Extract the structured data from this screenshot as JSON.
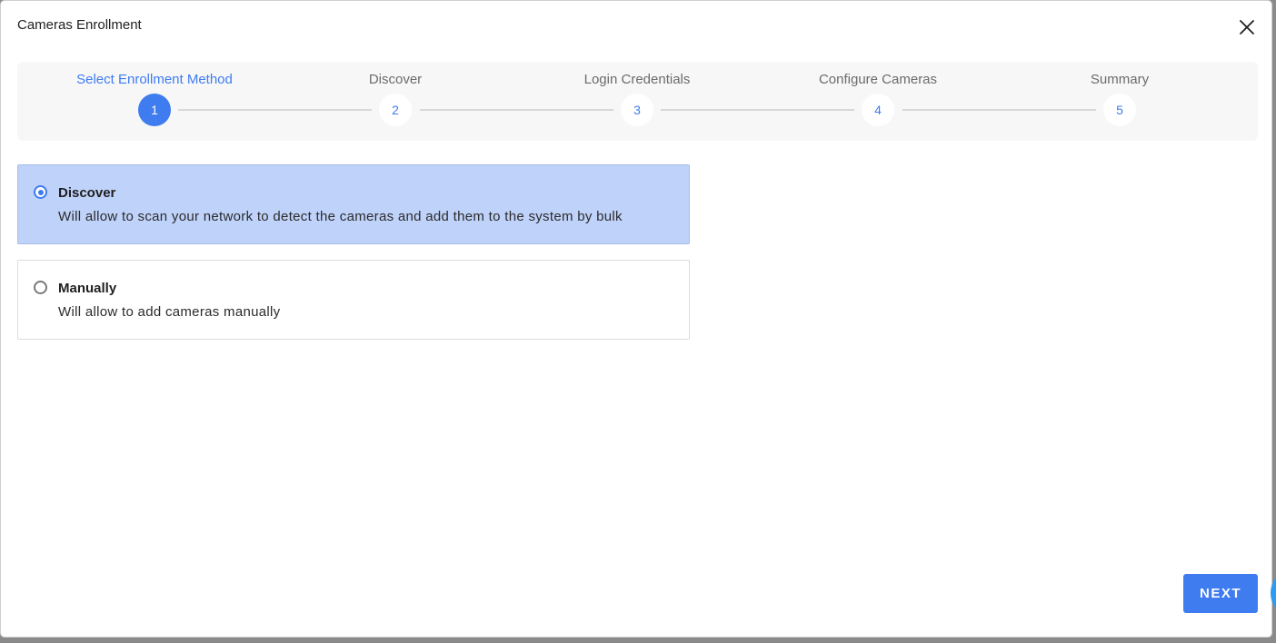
{
  "dialog": {
    "title": "Cameras Enrollment",
    "close_icon": "close-icon"
  },
  "stepper": {
    "steps": [
      {
        "label": "Select Enrollment Method",
        "number": "1",
        "active": true
      },
      {
        "label": "Discover",
        "number": "2",
        "active": false
      },
      {
        "label": "Login Credentials",
        "number": "3",
        "active": false
      },
      {
        "label": "Configure Cameras",
        "number": "4",
        "active": false
      },
      {
        "label": "Summary",
        "number": "5",
        "active": false
      }
    ]
  },
  "options": [
    {
      "title": "Discover",
      "description": "Will allow to scan your network to detect the cameras and add them to the system by bulk",
      "selected": true
    },
    {
      "title": "Manually",
      "description": "Will allow to add cameras manually",
      "selected": false
    }
  ],
  "footer": {
    "next_label": "NEXT"
  },
  "colors": {
    "accent": "#3f7cf0",
    "selected_bg": "#bfd2fa",
    "stepper_bg": "#f7f7f7"
  }
}
